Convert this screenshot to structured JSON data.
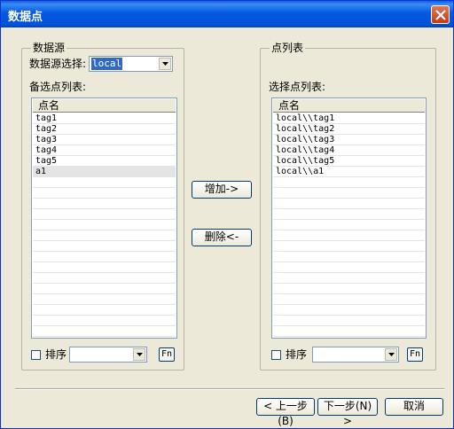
{
  "window": {
    "title": "数据点"
  },
  "source_group": {
    "label": "数据源",
    "select_label": "数据源选择:",
    "select_value": "local",
    "list_label": "备选点列表:",
    "column_header": "点名",
    "items": [
      "tag1",
      "tag2",
      "tag3",
      "tag4",
      "tag5",
      "a1"
    ],
    "selected_index": 5,
    "sort_label": "排序",
    "fn_label": "Fn"
  },
  "actions": {
    "add_label": "增加->",
    "remove_label": "删除<-"
  },
  "point_group": {
    "label": "点列表",
    "list_label": "选择点列表:",
    "column_header": "点名",
    "items": [
      "local\\\\tag1",
      "local\\\\tag2",
      "local\\\\tag3",
      "local\\\\tag4",
      "local\\\\tag5",
      "local\\\\a1"
    ],
    "sort_label": "排序",
    "fn_label": "Fn"
  },
  "footer": {
    "prev_label": "< 上一步(B)",
    "next_label": "下一步(N) >",
    "cancel_label": "取消"
  }
}
